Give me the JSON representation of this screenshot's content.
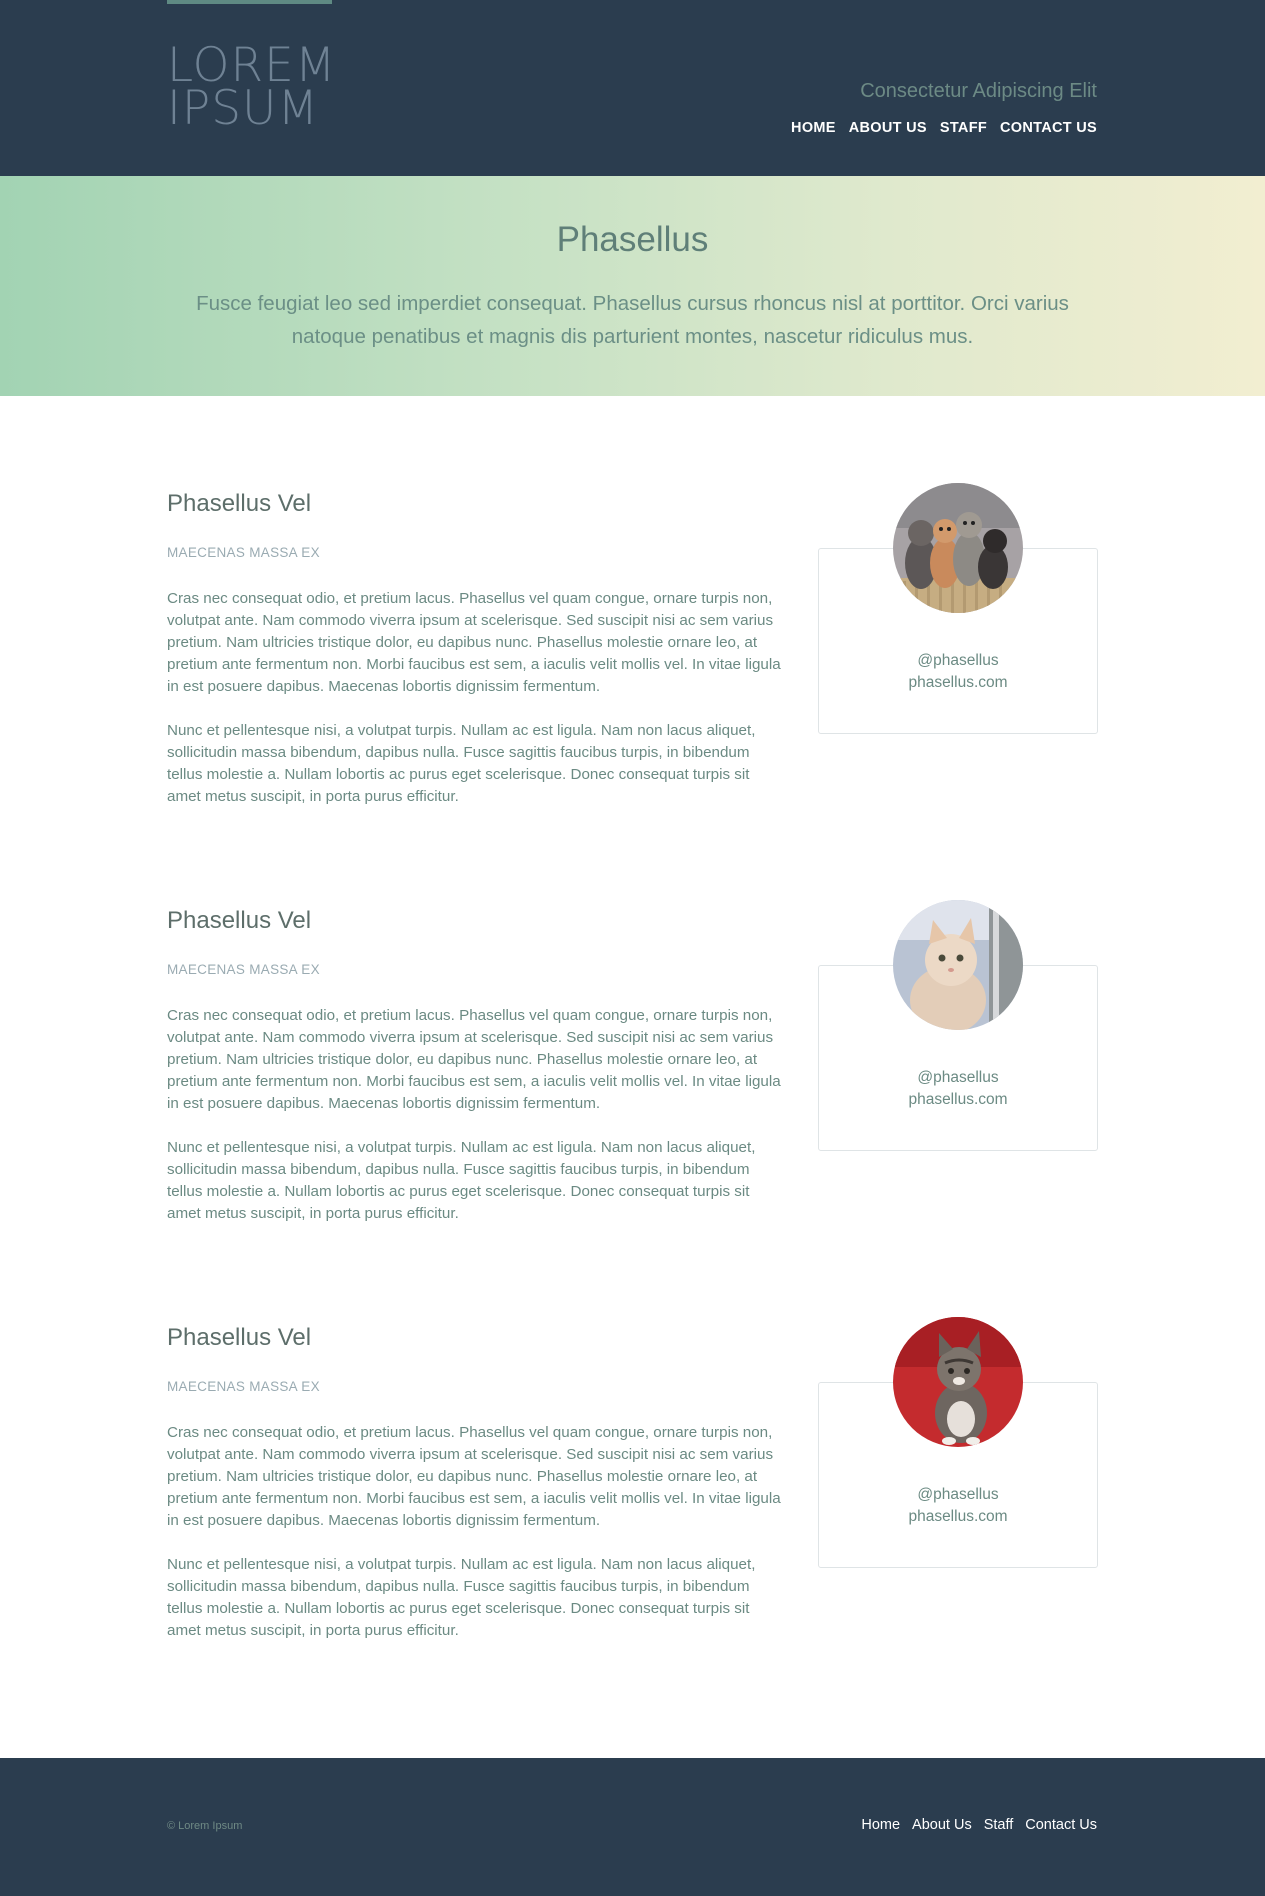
{
  "header": {
    "logo_line1": "LOREM",
    "logo_line2": "IPSUM",
    "tagline": "Consectetur Adipiscing Elit",
    "nav": [
      "HOME",
      "ABOUT US",
      "STAFF",
      "CONTACT US"
    ]
  },
  "hero": {
    "title": "Phasellus",
    "text": "Fusce feugiat leo sed imperdiet consequat. Phasellus cursus rhoncus nisl at porttitor. Orci varius natoque penatibus et magnis dis parturient montes, nascetur ridiculus mus."
  },
  "sections": [
    {
      "title": "Phasellus Vel",
      "subtitle": "MAECENAS MASSA EX",
      "p1": "Cras nec consequat odio, et pretium lacus. Phasellus vel quam congue, ornare turpis non, volutpat ante. Nam commodo viverra ipsum at scelerisque. Sed suscipit nisi ac sem varius pretium. Nam ultricies tristique dolor, eu dapibus nunc. Phasellus molestie ornare leo, at pretium ante fermentum non. Morbi faucibus est sem, a iaculis velit mollis vel. In vitae ligula in est posuere dapibus. Maecenas lobortis dignissim fermentum.",
      "p2": "Nunc et pellentesque nisi, a volutpat turpis. Nullam ac est ligula. Nam non lacus aliquet, sollicitudin massa bibendum, dapibus nulla. Fusce sagittis faucibus turpis, in bibendum tellus molestie a. Nullam lobortis ac purus eget scelerisque. Donec consequat turpis sit amet metus suscipit, in porta purus efficitur.",
      "handle": "@phasellus",
      "site": "phasellus.com"
    },
    {
      "title": "Phasellus Vel",
      "subtitle": "MAECENAS MASSA EX",
      "p1": "Cras nec consequat odio, et pretium lacus. Phasellus vel quam congue, ornare turpis non, volutpat ante. Nam commodo viverra ipsum at scelerisque. Sed suscipit nisi ac sem varius pretium. Nam ultricies tristique dolor, eu dapibus nunc. Phasellus molestie ornare leo, at pretium ante fermentum non. Morbi faucibus est sem, a iaculis velit mollis vel. In vitae ligula in est posuere dapibus. Maecenas lobortis dignissim fermentum.",
      "p2": "Nunc et pellentesque nisi, a volutpat turpis. Nullam ac est ligula. Nam non lacus aliquet, sollicitudin massa bibendum, dapibus nulla. Fusce sagittis faucibus turpis, in bibendum tellus molestie a. Nullam lobortis ac purus eget scelerisque. Donec consequat turpis sit amet metus suscipit, in porta purus efficitur.",
      "handle": "@phasellus",
      "site": "phasellus.com"
    },
    {
      "title": "Phasellus Vel",
      "subtitle": "MAECENAS MASSA EX",
      "p1": "Cras nec consequat odio, et pretium lacus. Phasellus vel quam congue, ornare turpis non, volutpat ante. Nam commodo viverra ipsum at scelerisque. Sed suscipit nisi ac sem varius pretium. Nam ultricies tristique dolor, eu dapibus nunc. Phasellus molestie ornare leo, at pretium ante fermentum non. Morbi faucibus est sem, a iaculis velit mollis vel. In vitae ligula in est posuere dapibus. Maecenas lobortis dignissim fermentum.",
      "p2": "Nunc et pellentesque nisi, a volutpat turpis. Nullam ac est ligula. Nam non lacus aliquet, sollicitudin massa bibendum, dapibus nulla. Fusce sagittis faucibus turpis, in bibendum tellus molestie a. Nullam lobortis ac purus eget scelerisque. Donec consequat turpis sit amet metus suscipit, in porta purus efficitur.",
      "handle": "@phasellus",
      "site": "phasellus.com"
    }
  ],
  "footer": {
    "copyright": "© Lorem Ipsum",
    "nav": [
      "Home",
      "About Us",
      "Staff",
      "Contact Us"
    ]
  }
}
